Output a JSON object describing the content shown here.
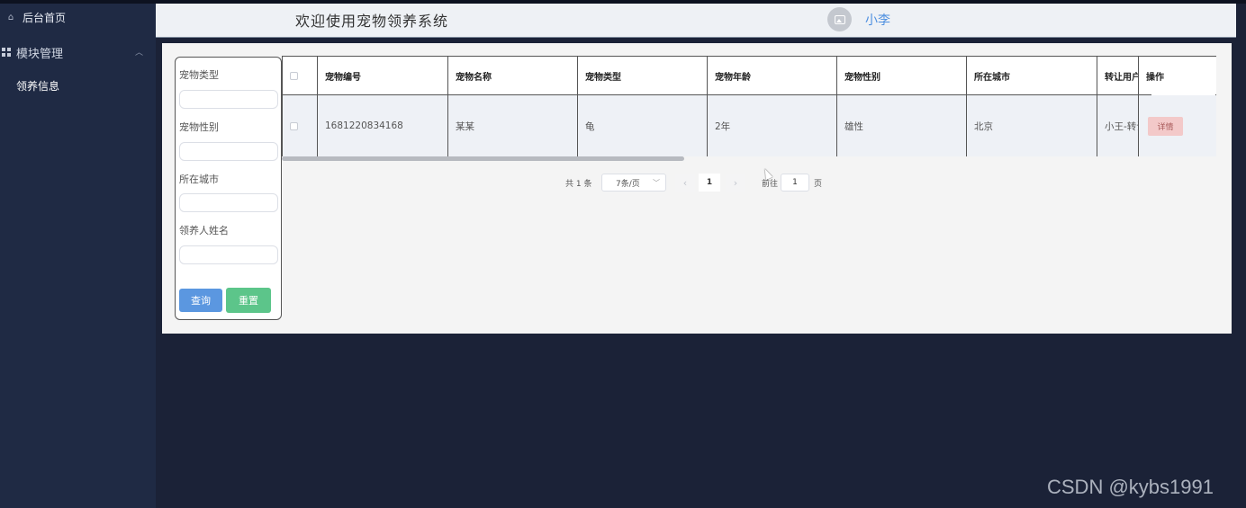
{
  "sidebar": {
    "home_label": "后台首页",
    "module_label": "模块管理",
    "sub_item_label": "领养信息"
  },
  "header": {
    "welcome": "欢迎使用宠物领养系统",
    "username": "小李"
  },
  "search": {
    "fields": [
      {
        "label": "宠物类型",
        "value": ""
      },
      {
        "label": "宠物性别",
        "value": ""
      },
      {
        "label": "所在城市",
        "value": ""
      },
      {
        "label": "领养人姓名",
        "value": ""
      }
    ],
    "query_label": "查询",
    "reset_label": "重置"
  },
  "table": {
    "columns": [
      "宠物编号",
      "宠物名称",
      "宠物类型",
      "宠物年龄",
      "宠物性别",
      "所在城市",
      "转让用户",
      "操作"
    ],
    "rows": [
      {
        "id": "1681220834168",
        "name": "某某",
        "type": "龟",
        "age": "2年",
        "sex": "雄性",
        "city": "北京",
        "user": "小王-转让",
        "action": "详情"
      }
    ]
  },
  "pagination": {
    "total": "共 1 条",
    "page_size": "7条/页",
    "current_page": "1",
    "goto_label": "前往",
    "goto_value": "1",
    "page_suffix": "页"
  },
  "watermark": "CSDN @kybs1991",
  "colors": {
    "sidebar_bg": "#1f2a44",
    "header_bg": "#eef1f5",
    "query_button": "#5b97e0",
    "reset_button": "#5cc58a",
    "detail_button": "#f3c9c9",
    "username": "#4d8fe0"
  }
}
